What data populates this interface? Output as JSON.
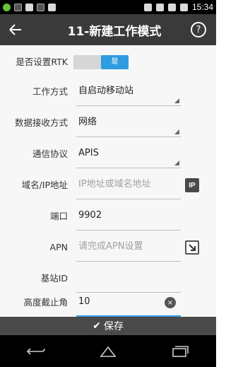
{
  "status_bar": {
    "time": "15:34",
    "icons": [
      "app-notification-icon",
      "image-icon",
      "sync-icon",
      "image-icon",
      "wifi-icon",
      "sim-icon"
    ]
  },
  "header": {
    "title": "11-新建工作模式",
    "back_icon": "back-arrow-icon",
    "help_label": "?"
  },
  "form": {
    "rtk": {
      "label": "是否设置RTK",
      "toggle_text": "是",
      "value": true
    },
    "work_mode": {
      "label": "工作方式",
      "value": "自启动移动站"
    },
    "data_receive": {
      "label": "数据接收方式",
      "value": "网络"
    },
    "protocol": {
      "label": "通信协议",
      "value": "APIS"
    },
    "domain_ip": {
      "label": "域名/IP地址",
      "placeholder": "IP地址或域名地址",
      "icon_text": "IP"
    },
    "port": {
      "label": "端口",
      "value": "9902"
    },
    "apn": {
      "label": "APN",
      "placeholder": "请完成APN设置"
    },
    "base_id": {
      "label": "基站ID",
      "value": ""
    },
    "cutoff_angle": {
      "label": "高度截止角",
      "value": "10",
      "clear_icon": "×"
    }
  },
  "footer": {
    "save_label": "保存",
    "save_icon": "✔"
  },
  "colors": {
    "accent": "#2f9be0",
    "appbar": "#3a3a3a",
    "savebar": "#4a4a4a"
  }
}
